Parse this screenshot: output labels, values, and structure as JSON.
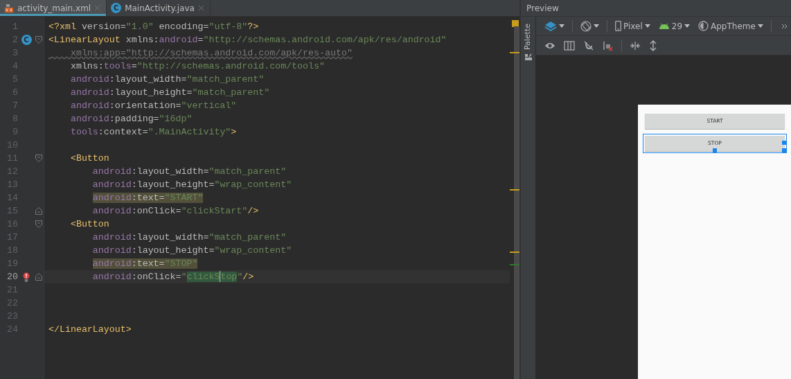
{
  "tabs": [
    {
      "label": "activity_main.xml",
      "kind": "xml",
      "selected": true
    },
    {
      "label": "MainActivity.java",
      "kind": "class",
      "badge": "C",
      "selected": false
    }
  ],
  "editor": {
    "lines": [
      {
        "number": "1",
        "current": false,
        "segments": [
          {
            "text": "<?xml",
            "kind": "tag"
          },
          {
            "text": " version=",
            "kind": "attr"
          },
          {
            "text": "\"1.0\"",
            "kind": "value"
          },
          {
            "text": " encoding=",
            "kind": "attr"
          },
          {
            "text": "\"utf-8\"",
            "kind": "value"
          },
          {
            "text": "?>",
            "kind": "tag"
          }
        ]
      },
      {
        "number": "2",
        "current": false,
        "markers": [
          {
            "kind": "class",
            "text": "C"
          },
          {
            "kind": "fold-start"
          }
        ],
        "segments": [
          {
            "text": "<LinearLayout",
            "kind": "tag"
          },
          {
            "text": " xmlns:",
            "kind": "attr"
          },
          {
            "text": "android",
            "kind": "ns"
          },
          {
            "text": "=",
            "kind": "attr"
          },
          {
            "text": "\"http://schemas.android.com/apk/res/android\"",
            "kind": "value"
          }
        ]
      },
      {
        "number": "3",
        "current": false,
        "segments": [
          {
            "text": "    xmlns:app=\"http://schemas.android.com/apk/res-auto\"",
            "kind": "unused"
          }
        ]
      },
      {
        "number": "4",
        "current": false,
        "segments": [
          {
            "text": "    xmlns:",
            "kind": "attr"
          },
          {
            "text": "tools",
            "kind": "ns"
          },
          {
            "text": "=",
            "kind": "attr"
          },
          {
            "text": "\"http://schemas.android.com/tools\"",
            "kind": "value"
          }
        ]
      },
      {
        "number": "5",
        "current": false,
        "segments": [
          {
            "text": "    android",
            "kind": "ns"
          },
          {
            "text": ":layout_width=",
            "kind": "attr"
          },
          {
            "text": "\"match_parent\"",
            "kind": "value"
          }
        ]
      },
      {
        "number": "6",
        "current": false,
        "segments": [
          {
            "text": "    android",
            "kind": "ns"
          },
          {
            "text": ":layout_height=",
            "kind": "attr"
          },
          {
            "text": "\"match_parent\"",
            "kind": "value"
          }
        ]
      },
      {
        "number": "7",
        "current": false,
        "segments": [
          {
            "text": "    android",
            "kind": "ns"
          },
          {
            "text": ":orientation=",
            "kind": "attr"
          },
          {
            "text": "\"vertical\"",
            "kind": "value"
          }
        ]
      },
      {
        "number": "8",
        "current": false,
        "segments": [
          {
            "text": "    android",
            "kind": "ns"
          },
          {
            "text": ":padding=",
            "kind": "attr"
          },
          {
            "text": "\"16dp\"",
            "kind": "value"
          }
        ]
      },
      {
        "number": "9",
        "current": false,
        "segments": [
          {
            "text": "    tools",
            "kind": "ns"
          },
          {
            "text": ":context=",
            "kind": "attr"
          },
          {
            "text": "\".MainActivity\"",
            "kind": "value"
          },
          {
            "text": ">",
            "kind": "tag"
          }
        ]
      },
      {
        "number": "10",
        "current": false
      },
      {
        "number": "11",
        "current": false,
        "markers": [
          {
            "kind": "fold-start"
          }
        ],
        "segments": [
          {
            "text": "    <Button",
            "kind": "tag"
          }
        ]
      },
      {
        "number": "12",
        "current": false,
        "segments": [
          {
            "text": "        android",
            "kind": "ns"
          },
          {
            "text": ":layout_width=",
            "kind": "attr"
          },
          {
            "text": "\"match_parent\"",
            "kind": "value"
          }
        ]
      },
      {
        "number": "13",
        "current": false,
        "segments": [
          {
            "text": "        android",
            "kind": "ns"
          },
          {
            "text": ":layout_height=",
            "kind": "attr"
          },
          {
            "text": "\"wrap_content\"",
            "kind": "value"
          }
        ]
      },
      {
        "number": "14",
        "current": false,
        "segments": [
          {
            "text": "        android",
            "kind": "ns",
            "highlighted": true
          },
          {
            "text": ":text=",
            "kind": "attr",
            "highlighted": true
          },
          {
            "text": "\"START\"",
            "kind": "value",
            "highlighted": true
          }
        ]
      },
      {
        "number": "15",
        "current": false,
        "markers": [
          {
            "kind": "fold-end"
          }
        ],
        "segments": [
          {
            "text": "        android",
            "kind": "ns"
          },
          {
            "text": ":onClick=",
            "kind": "attr"
          },
          {
            "text": "\"clickStart\"",
            "kind": "value"
          },
          {
            "text": "/>",
            "kind": "tag"
          }
        ]
      },
      {
        "number": "16",
        "current": false,
        "markers": [
          {
            "kind": "fold-start"
          }
        ],
        "segments": [
          {
            "text": "    <Button",
            "kind": "tag"
          }
        ]
      },
      {
        "number": "17",
        "current": false,
        "segments": [
          {
            "text": "        android",
            "kind": "ns"
          },
          {
            "text": ":layout_width=",
            "kind": "attr"
          },
          {
            "text": "\"match_parent\"",
            "kind": "value"
          }
        ]
      },
      {
        "number": "18",
        "current": false,
        "segments": [
          {
            "text": "        android",
            "kind": "ns"
          },
          {
            "text": ":layout_height=",
            "kind": "attr"
          },
          {
            "text": "\"wrap_content\"",
            "kind": "value"
          }
        ]
      },
      {
        "number": "19",
        "current": false,
        "segments": [
          {
            "text": "        android",
            "kind": "ns",
            "highlighted": true
          },
          {
            "text": ":text=",
            "kind": "attr",
            "highlighted": true
          },
          {
            "text": "\"STOP\"",
            "kind": "value",
            "highlighted": true
          }
        ]
      },
      {
        "number": "20",
        "current": true,
        "markers": [
          {
            "kind": "error"
          },
          {
            "kind": "fold-end"
          }
        ],
        "segments": [
          {
            "text": "        android",
            "kind": "ns"
          },
          {
            "text": ":onClick=",
            "kind": "attr"
          },
          {
            "text": "\"",
            "kind": "value"
          },
          {
            "text": "clickS",
            "kind": "match"
          },
          {
            "kind": "caret"
          },
          {
            "text": "top",
            "kind": "match"
          },
          {
            "text": "\"",
            "kind": "value"
          },
          {
            "text": "/>",
            "kind": "tag"
          }
        ]
      },
      {
        "number": "21",
        "current": false
      },
      {
        "number": "22",
        "current": false
      },
      {
        "number": "23",
        "current": false
      },
      {
        "number": "24",
        "current": false,
        "segments": [
          {
            "text": "</LinearLayout>",
            "kind": "tag"
          }
        ]
      }
    ]
  },
  "preview": {
    "title": "Preview",
    "palette_label": "Palette",
    "toolbar": {
      "device": "Pixel",
      "api": "29",
      "theme": "AppTheme"
    },
    "device_buttons": [
      {
        "label": "START",
        "selected": false
      },
      {
        "label": "STOP",
        "selected": true
      }
    ]
  }
}
